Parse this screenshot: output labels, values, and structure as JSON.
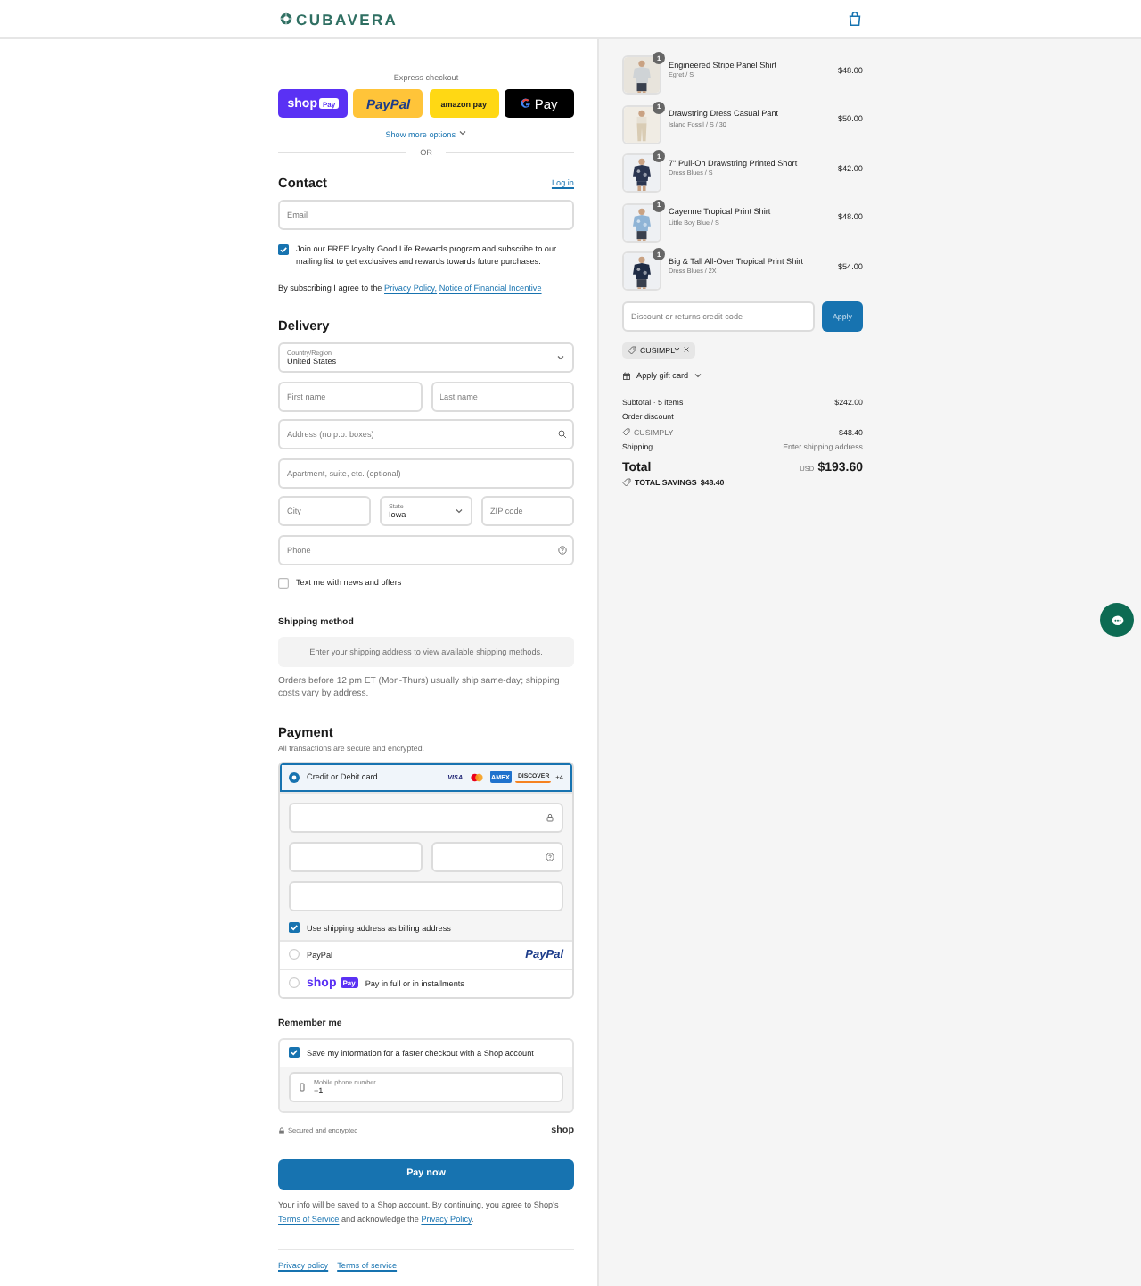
{
  "header": {
    "brand": "CUBAVERA"
  },
  "express": {
    "label": "Express checkout",
    "buttons": [
      {
        "kind": "shop",
        "label": "shop",
        "badge": "Pay"
      },
      {
        "kind": "paypal",
        "label": "PayPal"
      },
      {
        "kind": "amazon",
        "label": "amazon pay"
      },
      {
        "kind": "gpay",
        "label": "Pay"
      }
    ],
    "more": "Show more options",
    "or": "OR"
  },
  "contact": {
    "title": "Contact",
    "login": "Log in",
    "email": {
      "placeholder": "Email"
    },
    "optin": {
      "checked": true,
      "label": "Join our FREE loyalty Good Life Rewards program and subscribe to our mailing list to get exclusives and rewards towards future purchases."
    },
    "legal": {
      "text": "By subscribing I agree to the",
      "links": [
        "Privacy Policy,",
        "Notice of Financial Incentive"
      ]
    }
  },
  "delivery": {
    "title": "Delivery",
    "rows": [
      [
        {
          "kind": "select",
          "label": "Country/Region",
          "value": "United States"
        }
      ],
      [
        {
          "kind": "text",
          "placeholder": "First name"
        },
        {
          "kind": "text",
          "placeholder": "Last name"
        }
      ],
      [
        {
          "kind": "search",
          "placeholder": "Address (no p.o. boxes)"
        }
      ],
      [
        {
          "kind": "text",
          "placeholder": "Apartment, suite, etc. (optional)"
        }
      ],
      [
        {
          "kind": "text",
          "placeholder": "City"
        },
        {
          "kind": "select",
          "label": "State",
          "value": "Iowa"
        },
        {
          "kind": "text",
          "placeholder": "ZIP code"
        }
      ],
      [
        {
          "kind": "help",
          "placeholder": "Phone"
        }
      ]
    ],
    "sms": {
      "checked": false,
      "label": "Text me with news and offers"
    }
  },
  "shipping": {
    "title": "Shipping method",
    "notice": "Enter your shipping address to view available shipping methods.",
    "note": "Orders before 12 pm ET (Mon-Thurs) usually ship same-day; shipping costs vary by address."
  },
  "payment": {
    "title": "Payment",
    "subtitle": "All transactions are secure and encrypted.",
    "methods": [
      {
        "kind": "card",
        "label": "Credit or Debit card",
        "selected": true,
        "brands": [
          {
            "kind": "visa",
            "label": "VISA"
          },
          {
            "kind": "mastercard"
          },
          {
            "kind": "amex",
            "label": "AMEX"
          },
          {
            "kind": "discover",
            "label": "DISCOVER"
          }
        ],
        "more": "+4"
      },
      {
        "kind": "paypal",
        "label": "PayPal",
        "selected": false,
        "logo": "PayPal"
      },
      {
        "kind": "shop",
        "label": "Pay in full or in installments",
        "selected": false,
        "logo": "shop",
        "badge": "Pay"
      }
    ],
    "billing": {
      "checked": true,
      "label": "Use shipping address as billing address"
    }
  },
  "remember": {
    "title": "Remember me",
    "save": {
      "checked": true,
      "label": "Save my information for a faster checkout with a Shop account"
    },
    "phone": {
      "label": "Mobile phone number",
      "value": "+1"
    },
    "secure": "Secured and encrypted",
    "brand": "shop"
  },
  "pay": {
    "label": "Pay now"
  },
  "consent": {
    "a": "Your info will be saved to a Shop account. By continuing, you agree to Shop's",
    "terms": "Terms of Service",
    "b": "and acknowledge the",
    "privacy": "Privacy Policy",
    "c": "."
  },
  "footer_links": [
    "Privacy policy",
    "Terms of service"
  ],
  "cart": {
    "items": [
      {
        "name": "Engineered Stripe Panel Shirt",
        "variant": "Egret / S",
        "price": "$48.00",
        "quantity": "1"
      },
      {
        "name": "Drawstring Dress Casual Pant",
        "variant": "Island Fossil / S / 30",
        "price": "$50.00",
        "quantity": "1"
      },
      {
        "name": "7\" Pull-On Drawstring Printed Short",
        "variant": "Dress Blues / S",
        "price": "$42.00",
        "quantity": "1"
      },
      {
        "name": "Cayenne Tropical Print Shirt",
        "variant": "Little Boy Blue / S",
        "price": "$48.00",
        "quantity": "1"
      },
      {
        "name": "Big & Tall All-Over Tropical Print Shirt",
        "variant": "Dress Blues / 2X",
        "price": "$54.00",
        "quantity": "1"
      }
    ],
    "discount": {
      "placeholder": "Discount or returns credit code",
      "button": "Apply"
    },
    "code": "CUSIMPLY",
    "gift": "Apply gift card",
    "summary": {
      "subtotal_label": "Subtotal · 5 items",
      "subtotal": "$242.00",
      "discount_label": "Order discount",
      "code": "CUSIMPLY",
      "discount": "- $48.40",
      "shipping_label": "Shipping",
      "shipping": "Enter shipping address",
      "total_label": "Total",
      "currency": "USD",
      "total": "$193.60",
      "savings_label": "TOTAL SAVINGS",
      "savings": "$48.40"
    }
  }
}
